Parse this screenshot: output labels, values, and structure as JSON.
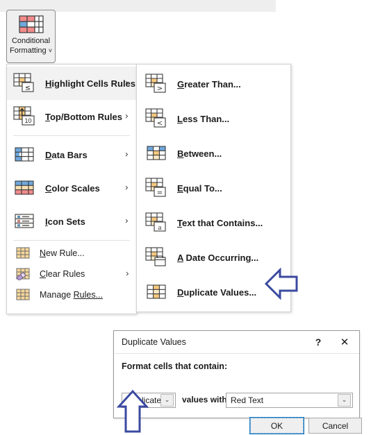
{
  "ribbon": {
    "cf_button": {
      "label_line1": "Conditional",
      "label_line2": "Formatting",
      "chevron": "˅",
      "icon": "conditional-formatting-grid-icon"
    }
  },
  "primary_menu": {
    "items": [
      {
        "label_pre": "H",
        "label_post": "ighlight Cells Rules",
        "icon": "highlight-cells-rules-icon",
        "arrow": "›",
        "highlighted": true
      },
      {
        "label_pre": "T",
        "label_post": "op/Bottom Rules",
        "icon": "top-bottom-rules-icon",
        "arrow": "›",
        "highlighted": false
      },
      {
        "label_pre": "D",
        "label_post": "ata Bars",
        "icon": "data-bars-icon",
        "arrow": "›",
        "highlighted": false
      },
      {
        "label_pre": "C",
        "label_post": "olor Scales",
        "icon": "color-scales-icon",
        "arrow": "›",
        "highlighted": false
      },
      {
        "label_pre": "I",
        "label_post": "con Sets",
        "icon": "icon-sets-icon",
        "arrow": "›",
        "highlighted": false
      }
    ],
    "commands": [
      {
        "label_pre": "N",
        "label_post": "ew Rule...",
        "icon": "new-rule-icon",
        "arrow": ""
      },
      {
        "label_pre": "C",
        "label_post": "lear Rules",
        "icon": "clear-rules-icon",
        "arrow": "›"
      },
      {
        "label_pre": "Manage ",
        "label_post": "Rules...",
        "icon": "manage-rules-icon",
        "arrow": "",
        "underline_at": 7
      }
    ]
  },
  "submenu": {
    "items": [
      {
        "label_pre": "G",
        "label_post": "reater Than...",
        "icon": "greater-than-icon"
      },
      {
        "label_pre": "L",
        "label_post": "ess Than...",
        "icon": "less-than-icon"
      },
      {
        "label_pre": "B",
        "label_post": "etween...",
        "icon": "between-icon"
      },
      {
        "label_pre": "E",
        "label_post": "qual To...",
        "icon": "equal-to-icon"
      },
      {
        "label_pre": "T",
        "label_post": "ext that Contains...",
        "icon": "text-that-contains-icon"
      },
      {
        "label_pre": "A",
        "label_post": " Date Occurring...",
        "icon": "a-date-occurring-icon"
      },
      {
        "label_pre": "D",
        "label_post": "uplicate Values...",
        "icon": "duplicate-values-icon"
      }
    ]
  },
  "dialog": {
    "title": "Duplicate Values",
    "help_glyph": "?",
    "close_glyph": "✕",
    "prompt": "Format cells that contain:",
    "duplicate_combo_value": "Duplicate",
    "values_with_label": "values with",
    "format_combo_value": "Red Text",
    "combo_arrow_glyph": "⌄",
    "ok_label": "OK",
    "cancel_label": "Cancel"
  },
  "annotations": {
    "arrow_color": "#3b4aa0",
    "arrow_left_target": "duplicate-values-menu-item",
    "arrow_up_target": "duplicate-combo"
  }
}
